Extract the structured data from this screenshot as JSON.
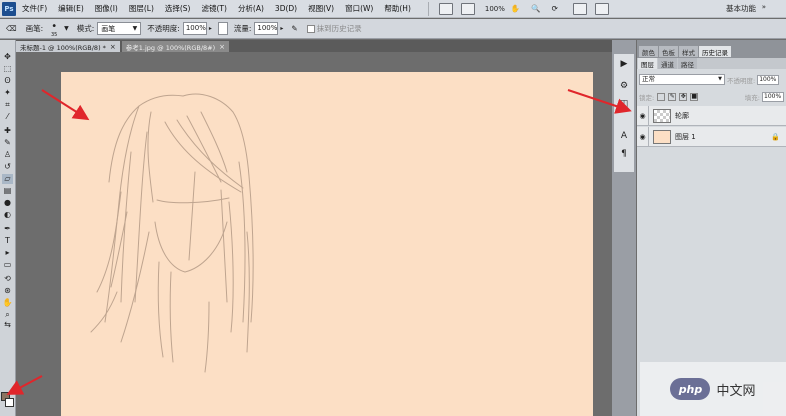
{
  "app": {
    "logo": "Ps"
  },
  "menu": {
    "items": [
      "文件(F)",
      "编辑(E)",
      "图像(I)",
      "图层(L)",
      "选择(S)",
      "滤镜(T)",
      "分析(A)",
      "3D(D)",
      "视图(V)",
      "窗口(W)",
      "帮助(H)"
    ],
    "zoom": "100%",
    "workspace": "基本功能",
    "workspace_arrow": "»"
  },
  "options": {
    "brush_label": "画笔:",
    "brush_size": "35",
    "mode_label": "模式:",
    "mode_value": "画笔",
    "opacity_label": "不透明度:",
    "opacity_value": "100%",
    "flow_label": "流量:",
    "flow_value": "100%",
    "history_label": "抹到历史记录"
  },
  "tabs": [
    {
      "label": "未标题-1 @ 100%(RGB/8) *",
      "active": true
    },
    {
      "label": "参考1.jpg @ 100%(RGB/8#)",
      "active": false
    }
  ],
  "panel": {
    "top_tabs": [
      "颜色",
      "色板",
      "样式",
      "历史记录"
    ],
    "tabs": [
      "图层",
      "通道",
      "路径"
    ],
    "blend_mode": "正常",
    "opacity_label": "不透明度:",
    "opacity_value": "100%",
    "lock_label": "锁定:",
    "fill_label": "填充:",
    "fill_value": "100%",
    "layers": [
      {
        "name": "轮廓",
        "thumb": "transparent"
      },
      {
        "name": "图层 1",
        "thumb": "peach"
      }
    ]
  },
  "watermark": {
    "logo": "php",
    "text": "中文网"
  },
  "colors": {
    "canvas": "#fcdfc5",
    "sketch": "#b49a86",
    "arrow": "#e0262b",
    "foreground": "#8b7360"
  }
}
